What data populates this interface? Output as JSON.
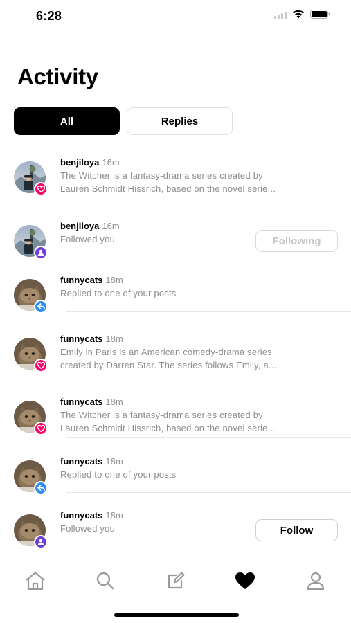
{
  "status_bar": {
    "time": "6:28"
  },
  "page_title": "Activity",
  "tabs": [
    {
      "label": "All",
      "active": true
    },
    {
      "label": "Replies",
      "active": false
    }
  ],
  "activities": [
    {
      "username": "benjiloya",
      "time": "16m",
      "lines": [
        "The Witcher is a fantasy-drama series created by",
        "Lauren Schmidt Hissrich, based on the novel serie..."
      ],
      "badge": "heart-icon",
      "avatar": "hiker",
      "button": null
    },
    {
      "username": "benjiloya",
      "time": "16m",
      "lines": [
        "Followed you"
      ],
      "badge": "person-icon",
      "avatar": "hiker",
      "button": {
        "label": "Following",
        "style": "following"
      }
    },
    {
      "username": "funnycats",
      "time": "18m",
      "lines": [
        "Replied to one of your posts"
      ],
      "badge": "reply-icon",
      "avatar": "cat",
      "button": null
    },
    {
      "username": "funnycats",
      "time": "18m",
      "lines": [
        "Emily in Paris is an American comedy-drama series",
        "created by Darren Star. The series follows Emily, a..."
      ],
      "badge": "heart-icon",
      "avatar": "cat",
      "button": null
    },
    {
      "username": "funnycats",
      "time": "18m",
      "lines": [
        "The Witcher is a fantasy-drama series created by",
        "Lauren Schmidt Hissrich, based on the novel serie..."
      ],
      "badge": "heart-icon",
      "avatar": "cat",
      "button": null
    },
    {
      "username": "funnycats",
      "time": "18m",
      "lines": [
        "Replied to one of your posts"
      ],
      "badge": "reply-icon",
      "avatar": "cat",
      "button": null
    },
    {
      "username": "funnycats",
      "time": "18m",
      "lines": [
        "Followed you"
      ],
      "badge": "person-icon",
      "avatar": "cat",
      "button": {
        "label": "Follow",
        "style": "follow"
      }
    }
  ],
  "tab_bar": {
    "items": [
      "home-icon",
      "search-icon",
      "compose-icon",
      "activity-heart-icon",
      "profile-icon"
    ],
    "active": "activity-heart-icon"
  },
  "colors": {
    "like": "#fe0169",
    "follow": "#6e3ddb",
    "reply": "#2a8ef2",
    "secondary_text": "#8e8e93"
  }
}
